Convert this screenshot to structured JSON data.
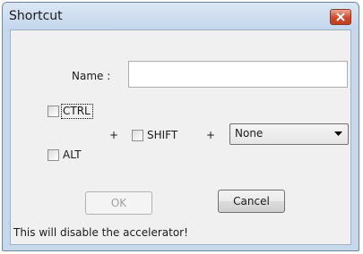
{
  "window": {
    "title": "Shortcut",
    "close_icon": "close-icon"
  },
  "form": {
    "name_label": "Name :",
    "name_value": "",
    "ctrl_label": "CTRL",
    "alt_label": "ALT",
    "shift_label": "SHIFT",
    "plus_1": "+",
    "plus_2": "+",
    "key_select_value": "None",
    "ctrl_checked": false,
    "alt_checked": false,
    "shift_checked": false
  },
  "buttons": {
    "ok_label": "OK",
    "cancel_label": "Cancel"
  },
  "status": {
    "message": "This will disable the accelerator!"
  }
}
